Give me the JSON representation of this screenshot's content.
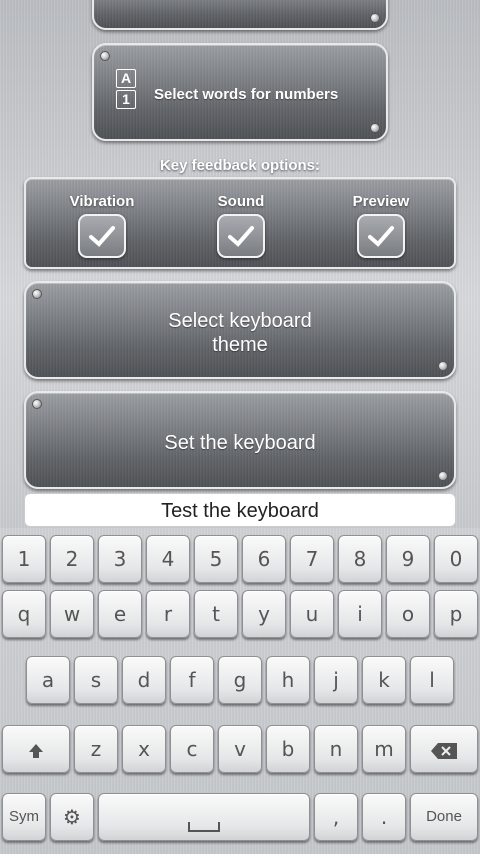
{
  "select_words_button": {
    "label": "Select words for numbers",
    "icon": "text-number-icon",
    "icon_letter": "A",
    "icon_digit": "1"
  },
  "key_feedback": {
    "title": "Key feedback options:",
    "options": [
      {
        "label": "Vibration",
        "checked": true
      },
      {
        "label": "Sound",
        "checked": true
      },
      {
        "label": "Preview",
        "checked": true
      }
    ]
  },
  "theme_button": {
    "label_line1": "Select keyboard",
    "label_line2": "theme"
  },
  "set_keyboard_button": {
    "label": "Set the keyboard"
  },
  "test_field": {
    "value": "Test the keyboard"
  },
  "keyboard": {
    "row1": [
      "1",
      "2",
      "3",
      "4",
      "5",
      "6",
      "7",
      "8",
      "9",
      "0"
    ],
    "row2": [
      "q",
      "w",
      "e",
      "r",
      "t",
      "y",
      "u",
      "i",
      "o",
      "p"
    ],
    "row3": [
      "a",
      "s",
      "d",
      "f",
      "g",
      "h",
      "j",
      "k",
      "l"
    ],
    "row4": [
      "z",
      "x",
      "c",
      "v",
      "b",
      "n",
      "m"
    ],
    "shift_icon": "shift-icon",
    "backspace_icon": "backspace-icon",
    "settings_icon": "gear-icon",
    "sym_label": "Sym",
    "comma_label": ",",
    "period_label": ".",
    "done_label": "Done",
    "space_label": "",
    "space_icon": "space-bar-icon"
  },
  "colors": {
    "button_face": "#6e7176",
    "key_face": "#eeeeef",
    "key_text": "#555555"
  }
}
